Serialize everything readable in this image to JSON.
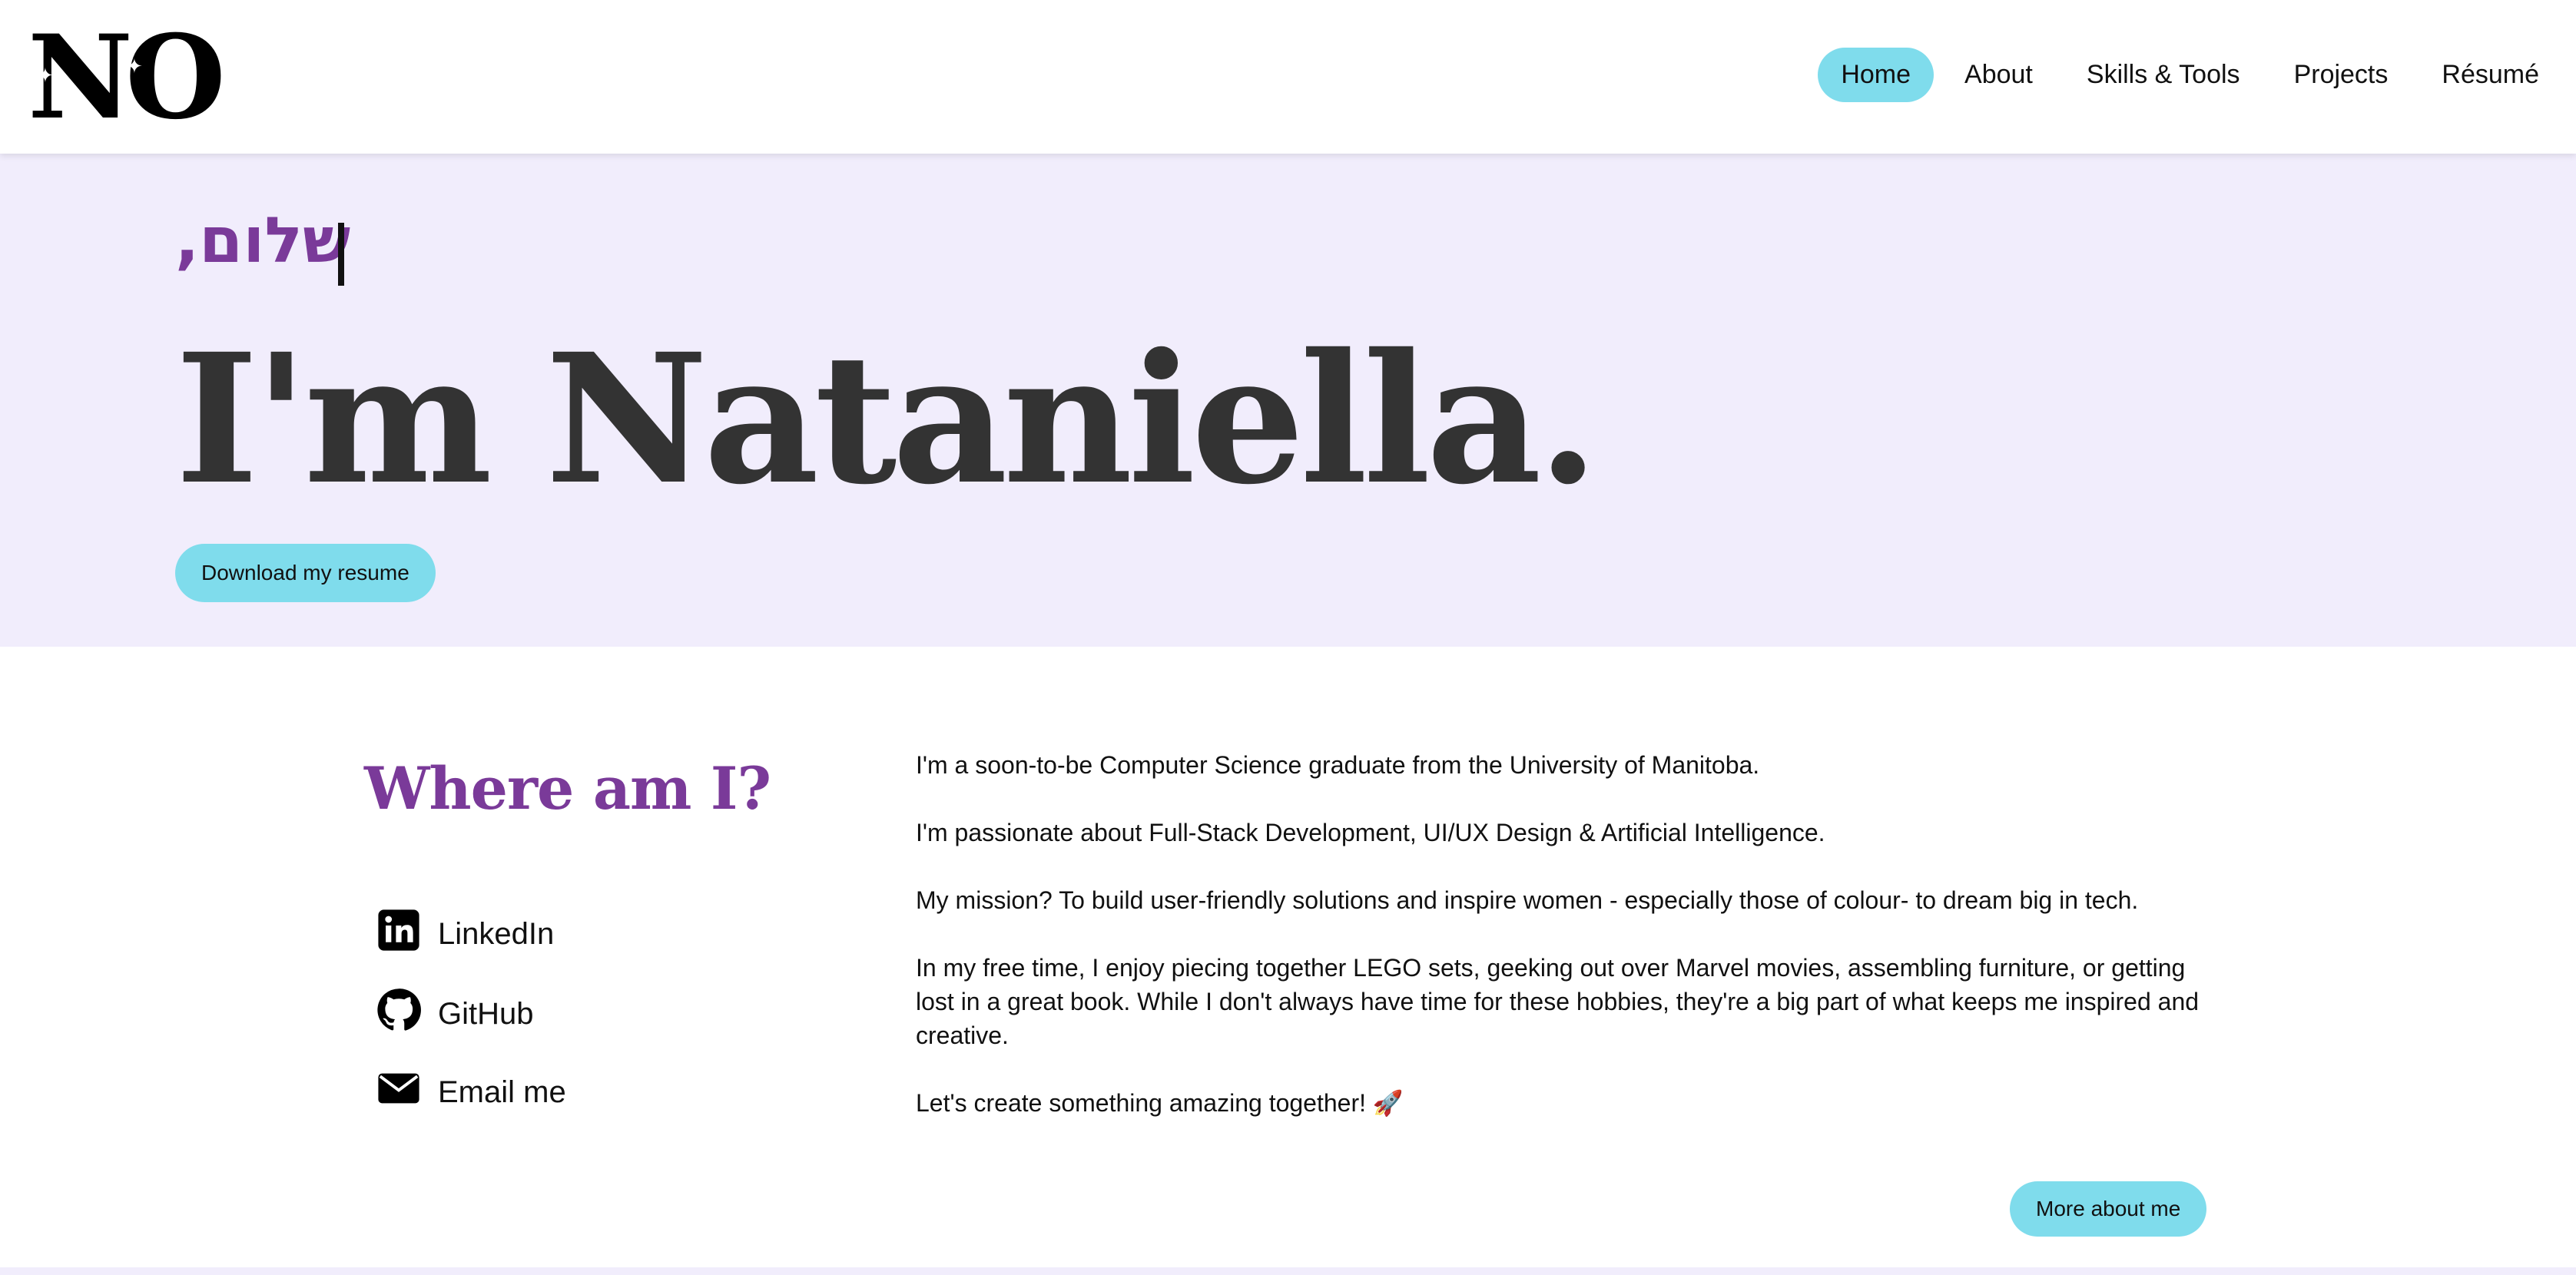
{
  "header": {
    "logo_text": "NO",
    "nav": [
      {
        "label": "Home",
        "active": true
      },
      {
        "label": "About",
        "active": false
      },
      {
        "label": "Skills & Tools",
        "active": false
      },
      {
        "label": "Projects",
        "active": false
      },
      {
        "label": "Résumé",
        "active": false
      }
    ]
  },
  "hero": {
    "greeting": "שלום,",
    "title": "I'm Nataniella.",
    "download_button": "Download my resume"
  },
  "about": {
    "heading": "Where am I?",
    "contacts": [
      {
        "label": "LinkedIn",
        "icon": "linkedin-icon"
      },
      {
        "label": "GitHub",
        "icon": "github-icon"
      },
      {
        "label": "Email me",
        "icon": "email-icon"
      }
    ],
    "bio": [
      "I'm a soon-to-be Computer Science graduate from the University of Manitoba.",
      "I'm passionate about Full-Stack Development, UI/UX Design & Artificial Intelligence.",
      "My mission? To build user-friendly solutions and inspire women - especially those of colour- to dream big in tech.",
      "In my free time, I enjoy piecing together LEGO sets, geeking out over Marvel movies, assembling furniture, or getting lost in a great book. While I don't always have time for these hobbies, they're a big part of what keeps me inspired and creative.",
      "Let's create something amazing together! 🚀"
    ],
    "more_button": "More about me"
  },
  "colors": {
    "accent": "#7fdcec",
    "purple": "#7a3a99",
    "hero_bg": "#f1edfc",
    "title": "#333333"
  }
}
